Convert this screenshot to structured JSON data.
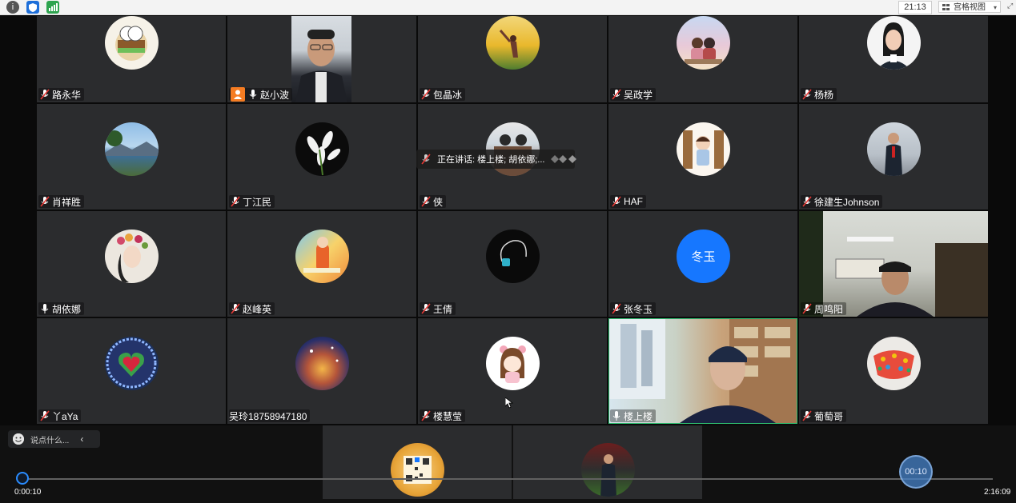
{
  "topbar": {
    "clock": "21:13",
    "view_label": "宫格视图",
    "icons": [
      "info-icon",
      "shield-icon",
      "signal-icon",
      "grid-view-icon",
      "fullscreen-icon"
    ]
  },
  "speaking_banner": {
    "text": "正在讲话: 楼上楼; 胡依娜;..."
  },
  "participants": [
    {
      "name": "路永华",
      "mic": "muted"
    },
    {
      "name": "赵小波",
      "mic": "on",
      "host": true
    },
    {
      "name": "包晶冰",
      "mic": "muted"
    },
    {
      "name": "吴政学",
      "mic": "muted"
    },
    {
      "name": "杨杨",
      "mic": "muted"
    },
    {
      "name": "肖祥胜",
      "mic": "muted"
    },
    {
      "name": "丁江民",
      "mic": "muted"
    },
    {
      "name": "侠",
      "mic": "muted"
    },
    {
      "name": "HAF",
      "mic": "muted"
    },
    {
      "name": "徐建生Johnson",
      "mic": "muted"
    },
    {
      "name": "胡依娜",
      "mic": "on"
    },
    {
      "name": "赵峰英",
      "mic": "muted"
    },
    {
      "name": "王倩",
      "mic": "muted"
    },
    {
      "name": "张冬玉",
      "mic": "muted",
      "avatar_text": "冬玉"
    },
    {
      "name": "周鸣阳",
      "mic": "muted"
    },
    {
      "name": "丫aYa",
      "mic": "muted"
    },
    {
      "name": "吴玲18758947180",
      "mic": "none"
    },
    {
      "name": "楼慧莹",
      "mic": "muted"
    },
    {
      "name": "楼上楼",
      "mic": "on"
    },
    {
      "name": "葡萄哥",
      "mic": "muted"
    }
  ],
  "chat": {
    "placeholder": "说点什么...",
    "icons": [
      "emoji-icon",
      "chevron-left-icon"
    ]
  },
  "playback": {
    "current_time": "0:00:10",
    "total_time": "2:16:09",
    "bubble_time": "00:10",
    "progress_fraction": 0.001
  },
  "colors": {
    "tile_bg": "#2b2c2e",
    "accent_blue": "#1677ff",
    "host_orange": "#f57c22",
    "progress_blue": "#2a8cff",
    "active_speaker_border": "#2fbf71"
  }
}
